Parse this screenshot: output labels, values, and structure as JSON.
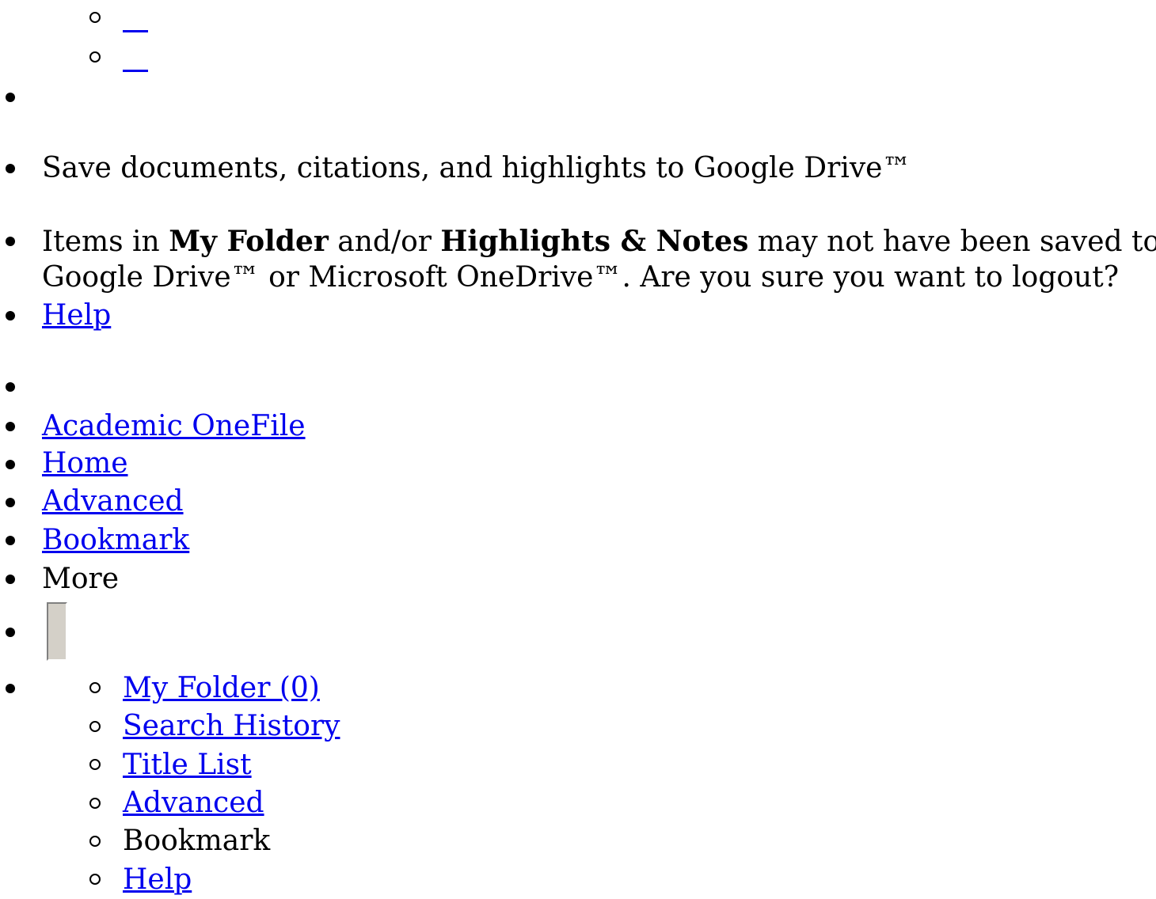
{
  "top_sublinks": [
    "",
    ""
  ],
  "drive_message": "Save documents, citations, and highlights to Google Drive™",
  "logout_warning": {
    "part1": "Items in ",
    "bold1": "My Folder",
    "part2": " and/or ",
    "bold2": "Highlights & Notes",
    "part3": " may not have been saved to",
    "line2": "Google Drive™ or Microsoft OneDrive™. Are you sure you want to logout?"
  },
  "help_link": "Help",
  "nav": {
    "academic_onefile": "Academic OneFile",
    "home": "Home",
    "advanced": "Advanced",
    "bookmark": "Bookmark",
    "more": "More"
  },
  "more_menu": {
    "my_folder": "My Folder (0)",
    "search_history": "Search History",
    "title_list": "Title List",
    "advanced": "Advanced",
    "bookmark": "Bookmark",
    "help": "Help"
  }
}
